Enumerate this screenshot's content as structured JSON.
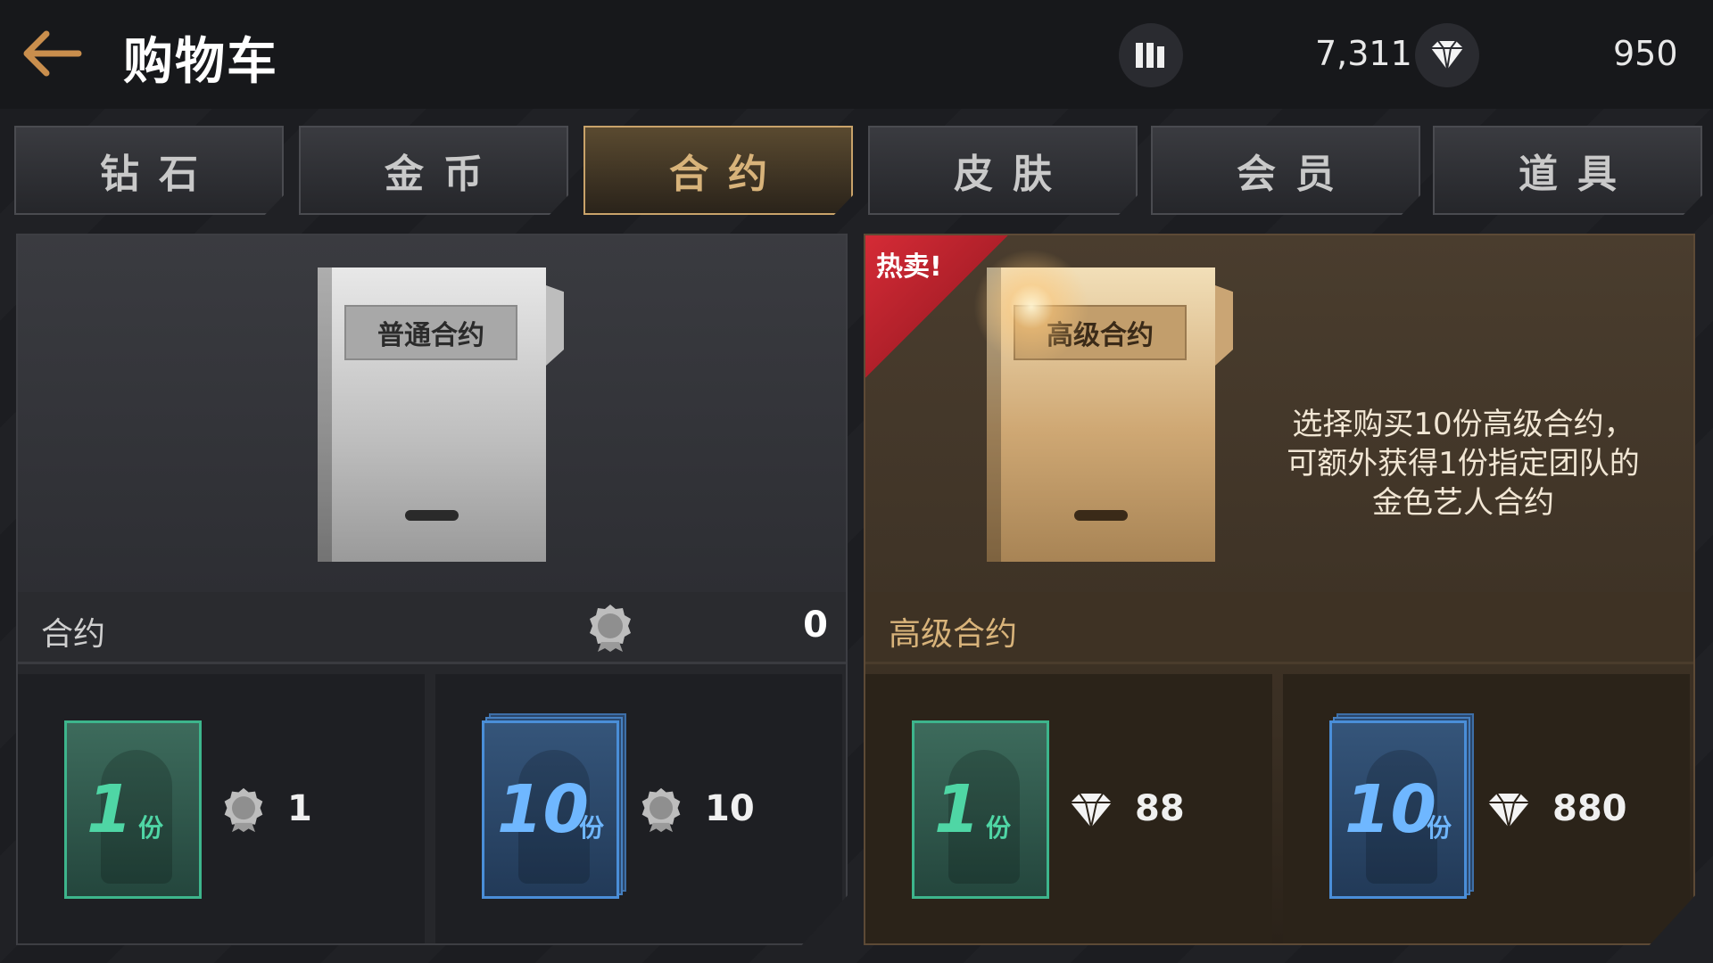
{
  "header": {
    "title": "购物车",
    "gold": "7,311",
    "diamonds": "950"
  },
  "tabs": [
    {
      "label": "钻石",
      "active": false
    },
    {
      "label": "金币",
      "active": false
    },
    {
      "label": "合约",
      "active": true
    },
    {
      "label": "皮肤",
      "active": false
    },
    {
      "label": "会员",
      "active": false
    },
    {
      "label": "道具",
      "active": false
    }
  ],
  "left_panel": {
    "book_label": "普通合约",
    "section_title": "合约",
    "owned_count": "0",
    "options": [
      {
        "qty": "1",
        "unit": "份",
        "currency": "seal-icon",
        "price": "1"
      },
      {
        "qty": "10",
        "unit": "份",
        "currency": "seal-icon",
        "price": "10"
      }
    ]
  },
  "right_panel": {
    "badge": "热卖!",
    "book_label": "高级合约",
    "description": [
      "选择购买10份高级合约，",
      "可额外获得1份指定团队的",
      "金色艺人合约"
    ],
    "section_title": "高级合约",
    "options": [
      {
        "qty": "1",
        "unit": "份",
        "currency": "diamond-icon",
        "price": "88"
      },
      {
        "qty": "10",
        "unit": "份",
        "currency": "diamond-icon",
        "price": "880"
      }
    ]
  },
  "colors": {
    "accent_gold": "#d8b37a",
    "hot_red": "#d52b36",
    "card_green": "#3db58c",
    "card_blue": "#4a8ed8"
  }
}
